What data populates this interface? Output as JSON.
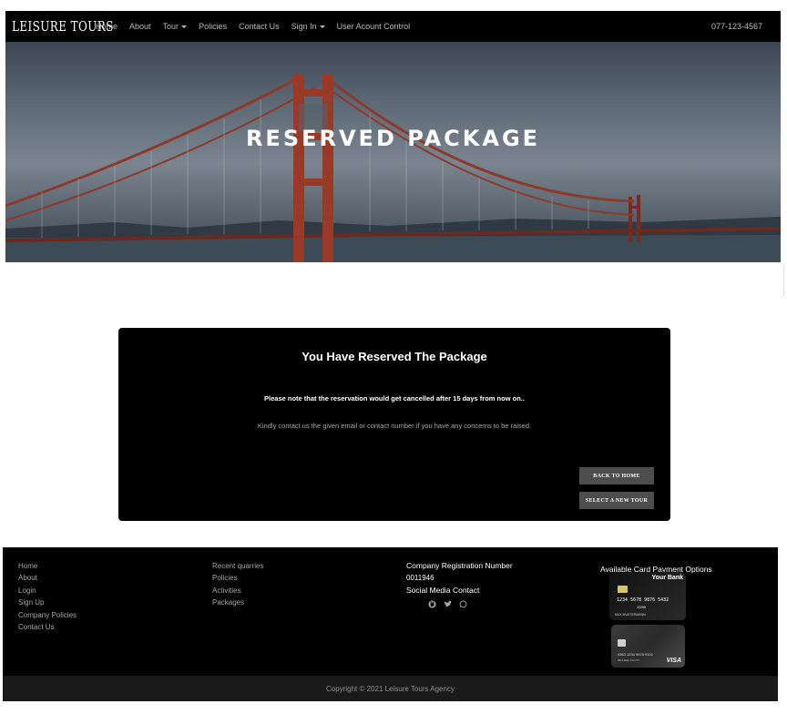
{
  "navbar": {
    "brand": "LEISURE TOURS",
    "items": [
      "Home",
      "About",
      "Tour",
      "Policies",
      "Contact Us",
      "Sign In",
      "User Acount Control"
    ],
    "phone": "077-123-4567"
  },
  "hero": {
    "title": "RESERVED PACKAGE"
  },
  "card": {
    "title": "You Have Reserved The Package",
    "note": "Please note that the reservation would get cancelled after 15 days from now on..",
    "subtext": "Kindly contact us the given email or contact number if you have any concerns to be raised.",
    "back_home_label": "BACK TO HOME",
    "select_tour_label": "SELECT A NEW TOUR"
  },
  "footer": {
    "col1": [
      "Home",
      "About",
      "Login",
      "Sign Up",
      "Company Policies",
      "Contact Us"
    ],
    "col2": [
      "Recent quarries",
      "Policies",
      "Activities",
      "Packages"
    ],
    "reg_heading": "Company Registration Number",
    "reg_number": "0011946",
    "social_heading": "Social Media Contact",
    "social_icons": [
      "github-icon",
      "twitter-icon",
      "whatsapp-icon"
    ],
    "payment_heading": "Available Card Payment Options",
    "card1": {
      "bank": "Your Bank",
      "number": "1234 5678 9876 5432",
      "expiry": "12/99",
      "holder": "MAX MUSTERMANN"
    },
    "card2": {
      "number": "4363 1234 5678 9101",
      "holder": "MICHAEL SCOTT",
      "brand": "VISA"
    }
  },
  "copyright": "Copyright © 2021 Leisure Tours Agency"
}
